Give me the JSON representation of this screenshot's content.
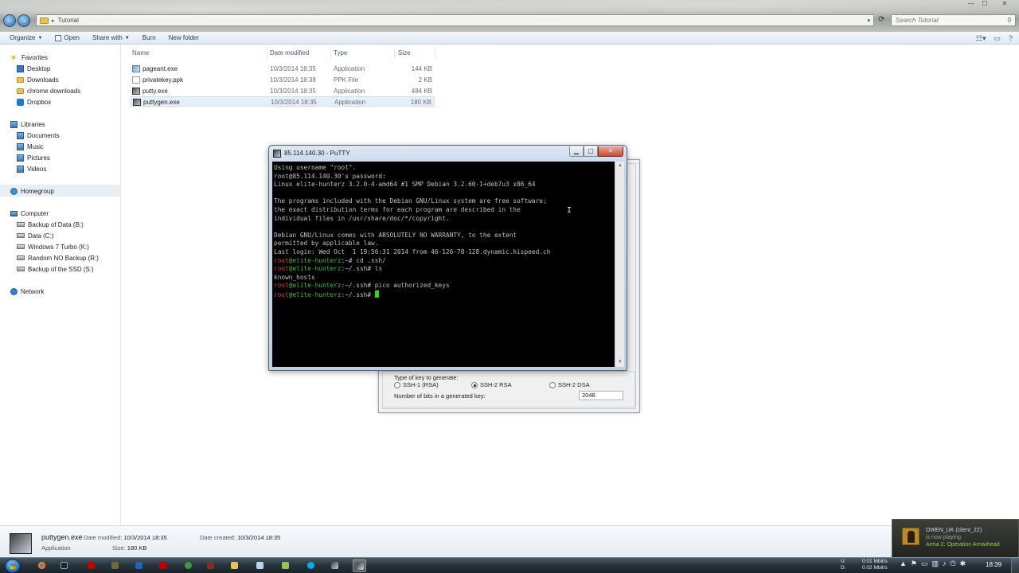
{
  "window": {
    "controls": {
      "minimize": "—",
      "maximize": "☐",
      "close": "✕"
    },
    "address": {
      "path": "Tutorial"
    },
    "search": {
      "placeholder": "Search Tutorial"
    }
  },
  "toolbar": {
    "organize": "Organize",
    "open": "Open",
    "share_with": "Share with",
    "burn": "Burn",
    "new_folder": "New folder"
  },
  "nav": {
    "favorites": "Favorites",
    "desktop": "Desktop",
    "downloads": "Downloads",
    "chrome_downloads": "chrome downloads",
    "dropbox": "Dropbox",
    "libraries": "Libraries",
    "documents": "Documents",
    "music": "Music",
    "pictures": "Pictures",
    "videos": "Videos",
    "homegroup": "Homegroup",
    "computer": "Computer",
    "drives": [
      "Backup of Data (B:)",
      "Data (C:)",
      "Windows 7 Turbo (K:)",
      "Random NO Backup (R:)",
      "Backup of the SSD (S:)"
    ],
    "network": "Network"
  },
  "columns": {
    "name": "Name",
    "date": "Date modified",
    "type": "Type",
    "size": "Size"
  },
  "files": [
    {
      "name": "pageant.exe",
      "date": "10/3/2014 18:35",
      "type": "Application",
      "size": "144 KB"
    },
    {
      "name": "privatekey.ppk",
      "date": "10/3/2014 18:38",
      "type": "PPK File",
      "size": "2 KB"
    },
    {
      "name": "putty.exe",
      "date": "10/3/2014 18:35",
      "type": "Application",
      "size": "484 KB"
    },
    {
      "name": "puttygen.exe",
      "date": "10/3/2014 18:35",
      "type": "Application",
      "size": "180 KB"
    }
  ],
  "putty": {
    "title": "85.114.140.30 - PuTTY",
    "lines": [
      "Using username \"root\".",
      "root@85.114.140.30's password:",
      "Linux elite-hunterz 3.2.0-4-amd64 #1 SMP Debian 3.2.60-1+deb7u3 x86_64",
      "",
      "The programs included with the Debian GNU/Linux system are free software;",
      "the exact distribution terms for each program are described in the",
      "individual files in /usr/share/doc/*/copyright.",
      "",
      "Debian GNU/Linux comes with ABSOLUTELY NO WARRANTY, to the extent",
      "permitted by applicable law.",
      "Last login: Wed Oct  1 19:56:31 2014 from 46-126-78-128.dynamic.hispeed.ch"
    ],
    "prompt_user": "root",
    "prompt_host": "@elite-hunterz",
    "prompts": [
      {
        "path": ":~# ",
        "cmd": "cd .ssh/"
      },
      {
        "path": ":~/.ssh# ",
        "cmd": "ls"
      }
    ],
    "ls_output": "known_hosts",
    "prompt2": {
      "path": ":~/.ssh# ",
      "cmd": "pico authorized_keys"
    },
    "prompt3": {
      "path": ":~/.ssh# ",
      "cmd": ""
    }
  },
  "puttygen": {
    "key_type_label": "Type of key to generate:",
    "options": [
      "SSH-1 (RSA)",
      "SSH-2 RSA",
      "SSH-2 DSA"
    ],
    "selected": "SSH-2 RSA",
    "bits_label": "Number of bits in a generated key:",
    "bits_value": "2048"
  },
  "details": {
    "name": "puttygen.exe",
    "type": "Application",
    "modified_label": "Date modified:",
    "modified": "10/3/2014 18:35",
    "created_label": "Date created:",
    "created": "10/3/2014 18:35",
    "size_label": "Size:",
    "size": "180 KB"
  },
  "steam": {
    "user": "OWEN_UK (client_22)",
    "status": "is now playing",
    "game": "Arma 2: Operation Arrowhead"
  },
  "tray": {
    "u_label": "U:",
    "d_label": "D:",
    "up": "0.01 Mbit/s",
    "down": "0.02 Mbit/s",
    "time": "18:39"
  }
}
